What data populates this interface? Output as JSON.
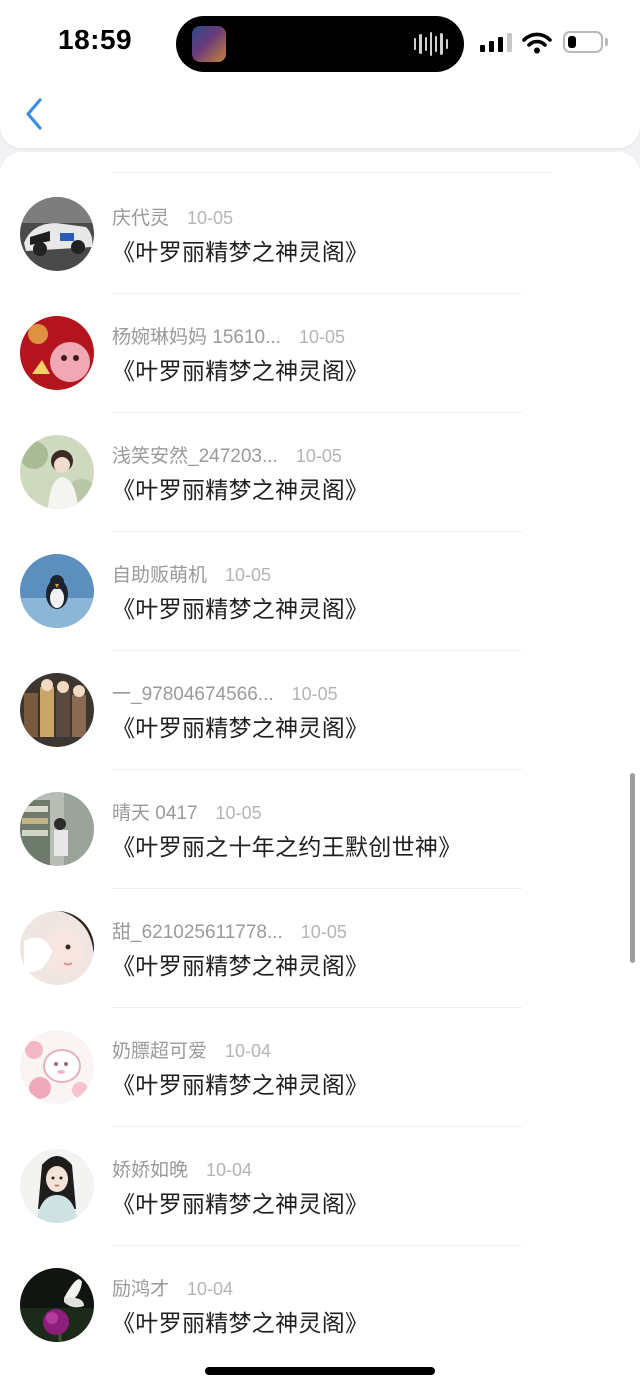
{
  "status_bar": {
    "time": "18:59"
  },
  "header": {
    "back_icon": "chevron-left-icon",
    "accent_color": "#3a8ee6"
  },
  "items": [
    {
      "name": "庆代灵",
      "date": "10-05",
      "title": "《叶罗丽精梦之神灵阁》",
      "avatar": "race-car"
    },
    {
      "name": "杨婉琳妈妈 15610...",
      "date": "10-05",
      "title": "《叶罗丽精梦之神灵阁》",
      "avatar": "red-festive"
    },
    {
      "name": "浅笑安然_247203...",
      "date": "10-05",
      "title": "《叶罗丽精梦之神灵阁》",
      "avatar": "girl-garden"
    },
    {
      "name": "自助贩萌机",
      "date": "10-05",
      "title": "《叶罗丽精梦之神灵阁》",
      "avatar": "penguin"
    },
    {
      "name": "一_97804674566...",
      "date": "10-05",
      "title": "《叶罗丽精梦之神灵阁》",
      "avatar": "anime-group"
    },
    {
      "name": "晴天 0417",
      "date": "10-05",
      "title": "《叶罗丽之十年之约王默创世神》",
      "avatar": "store-aisle"
    },
    {
      "name": "甜_621025611778...",
      "date": "10-05",
      "title": "《叶罗丽精梦之神灵阁》",
      "avatar": "girl-face"
    },
    {
      "name": "奶膘超可爱",
      "date": "10-04",
      "title": "《叶罗丽精梦之神灵阁》",
      "avatar": "pink-sheep"
    },
    {
      "name": "娇娇如晚",
      "date": "10-04",
      "title": "《叶罗丽精梦之神灵阁》",
      "avatar": "ancient-lady"
    },
    {
      "name": "励鸿才",
      "date": "10-04",
      "title": "《叶罗丽精梦之神灵阁》",
      "avatar": "butterfly-flower"
    }
  ]
}
